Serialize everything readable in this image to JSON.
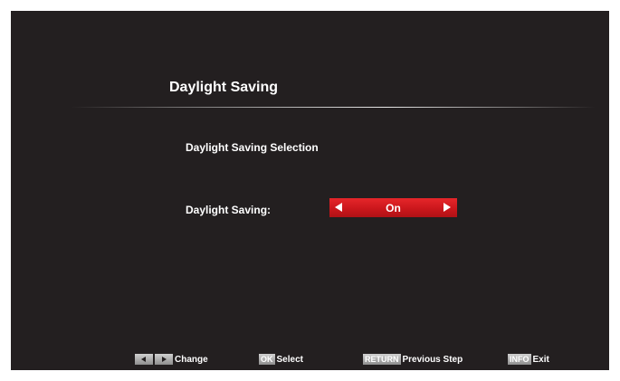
{
  "menu": {
    "title": "Daylight Saving",
    "subtitle": "Daylight Saving Selection"
  },
  "setting": {
    "label": "Daylight Saving:",
    "value": "On"
  },
  "footer": {
    "change_label": "Change",
    "ok_key": "OK",
    "select_label": "Select",
    "return_key": "RETURN",
    "previous_label": "Previous Step",
    "info_key": "INFO",
    "exit_label": "Exit"
  },
  "colors": {
    "background": "#231f20",
    "selector_red": "#d0191e",
    "text": "#ffffff"
  },
  "icons": {
    "selector_left": "left-arrow-icon",
    "selector_right": "right-arrow-icon",
    "footer_left": "left-key-icon",
    "footer_right": "right-key-icon"
  }
}
